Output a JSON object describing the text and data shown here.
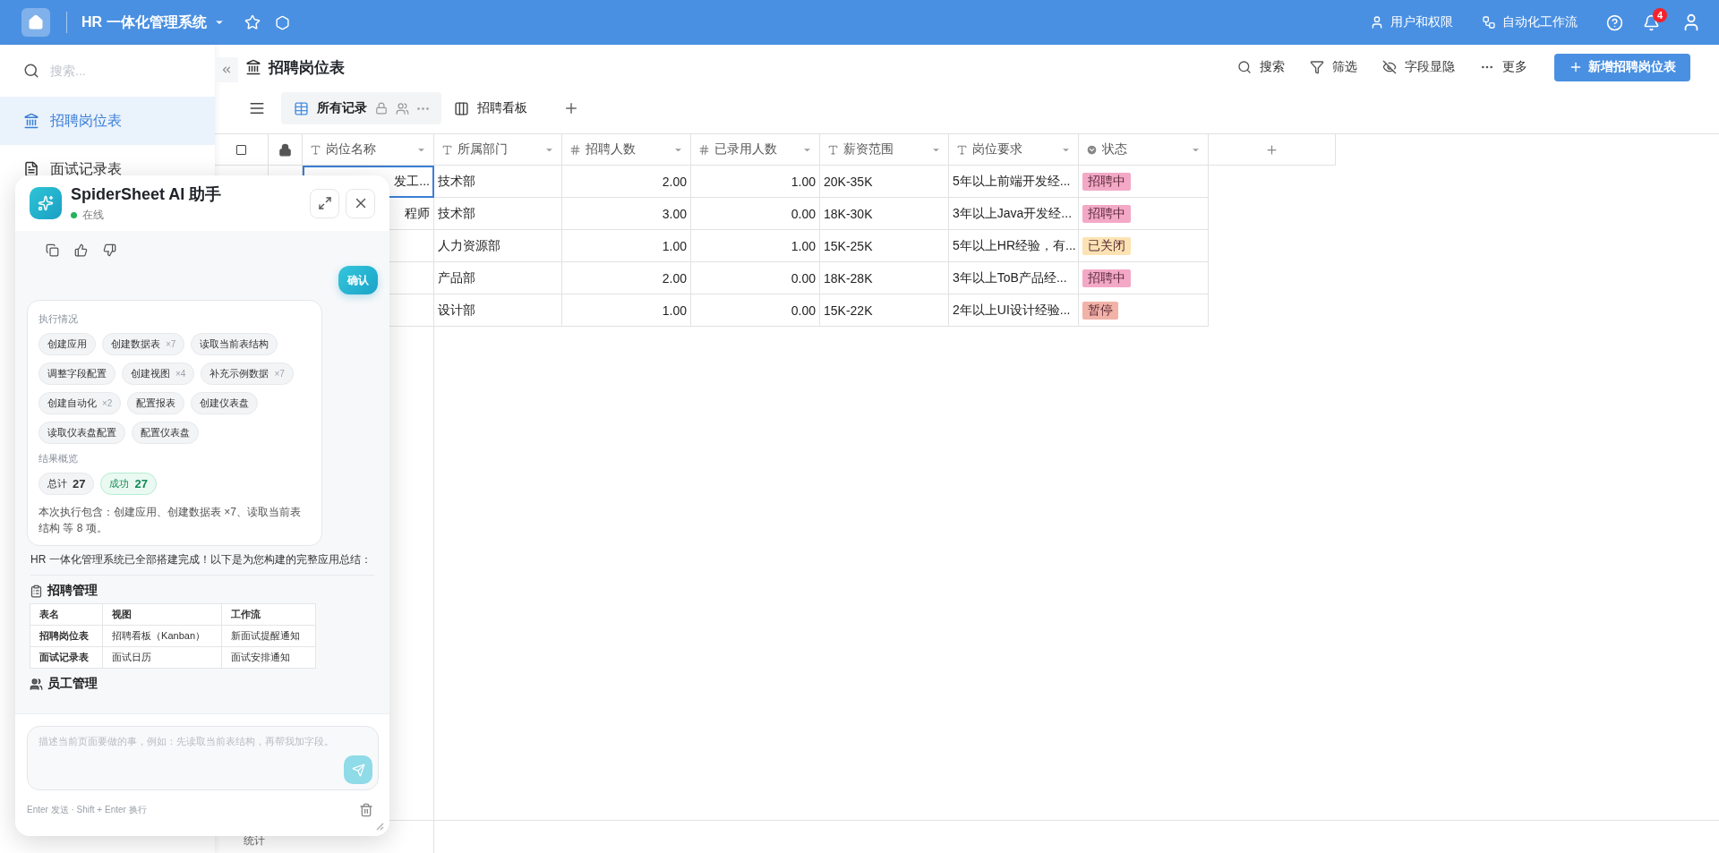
{
  "topbar": {
    "app_title": "HR 一体化管理系统",
    "links": [
      {
        "label": "用户和权限",
        "kind": "users"
      },
      {
        "label": "自动化工作流",
        "kind": "workflow"
      }
    ],
    "notification_count": "4"
  },
  "sidebar": {
    "search_placeholder": "搜索...",
    "items": [
      {
        "label": "招聘岗位表",
        "selected": true,
        "kind": "table"
      },
      {
        "label": "面试记录表",
        "selected": false,
        "kind": "form"
      }
    ]
  },
  "page": {
    "title": "招聘岗位表",
    "tools": [
      {
        "label": "搜索",
        "kind": "search"
      },
      {
        "label": "筛选",
        "kind": "filter"
      },
      {
        "label": "字段显隐",
        "kind": "visibility"
      },
      {
        "label": "更多",
        "kind": "more"
      }
    ],
    "add_button": "新增招聘岗位表"
  },
  "views": [
    {
      "label": "所有记录",
      "selected": true,
      "kind": "grid"
    },
    {
      "label": "招聘看板",
      "selected": false,
      "kind": "kanban"
    }
  ],
  "table": {
    "columns": [
      {
        "label": "岗位名称",
        "kind": "text"
      },
      {
        "label": "所属部门",
        "kind": "text"
      },
      {
        "label": "招聘人数",
        "kind": "number"
      },
      {
        "label": "已录用人数",
        "kind": "number"
      },
      {
        "label": "薪资范围",
        "kind": "text"
      },
      {
        "label": "岗位要求",
        "kind": "text"
      },
      {
        "label": "状态",
        "kind": "select"
      }
    ],
    "all_selected": false,
    "rows": [
      {
        "name_selected": true,
        "cells": [
          "发工...",
          "技术部",
          "2.00",
          "1.00",
          "20K-35K",
          "5年以上前端开发经..."
        ],
        "status": {
          "label": "招聘中",
          "color": "#f3a9c6"
        }
      },
      {
        "name_selected": false,
        "cells": [
          "程师",
          "技术部",
          "3.00",
          "0.00",
          "18K-30K",
          "3年以上Java开发经..."
        ],
        "status": {
          "label": "招聘中",
          "color": "#f3a9c6"
        }
      },
      {
        "name_selected": false,
        "cells": [
          "",
          "人力资源部",
          "1.00",
          "1.00",
          "15K-25K",
          "5年以上HR经验，有..."
        ],
        "status": {
          "label": "已关闭",
          "color": "#fde3b3"
        }
      },
      {
        "name_selected": false,
        "cells": [
          "",
          "产品部",
          "2.00",
          "0.00",
          "18K-28K",
          "3年以上ToB产品经..."
        ],
        "status": {
          "label": "招聘中",
          "color": "#f3a9c6"
        }
      },
      {
        "name_selected": false,
        "cells": [
          "",
          "设计部",
          "1.00",
          "0.00",
          "15K-22K",
          "2年以上UI设计经验..."
        ],
        "status": {
          "label": "暂停",
          "color": "#f2b2a7"
        }
      }
    ]
  },
  "status_bar": {
    "label": "统计"
  },
  "assistant": {
    "title": "SpiderSheet AI 助手",
    "status": "在线",
    "online": true,
    "confirm_label": "确认",
    "execution": {
      "heading": "执行情况",
      "steps": [
        {
          "label": "创建应用"
        },
        {
          "label": "创建数据表",
          "count": "×7"
        },
        {
          "label": "读取当前表结构"
        },
        {
          "label": "调整字段配置"
        },
        {
          "label": "创建视图",
          "count": "×4"
        },
        {
          "label": "补充示例数据",
          "count": "×7"
        },
        {
          "label": "创建自动化",
          "count": "×2"
        },
        {
          "label": "配置报表"
        },
        {
          "label": "创建仪表盘"
        },
        {
          "label": "读取仪表盘配置"
        },
        {
          "label": "配置仪表盘"
        }
      ],
      "result_heading": "结果概览",
      "results": [
        {
          "label": "总计",
          "value": "27",
          "kind": "total"
        },
        {
          "label": "成功",
          "value": "27",
          "kind": "success"
        }
      ],
      "summary": "本次执行包含：创建应用、创建数据表 ×7、读取当前表结构 等 8 项。"
    },
    "message": "HR 一体化管理系统已全部搭建完成！以下是为您构建的完整应用总结：",
    "sections": [
      {
        "heading": "招聘管理",
        "kind": "clipboard",
        "table": {
          "columns": [
            "表名",
            "视图",
            "工作流"
          ],
          "rows": [
            [
              "招聘岗位表",
              "招聘看板（Kanban）",
              "新面试提醒通知"
            ],
            [
              "面试记录表",
              "面试日历",
              "面试安排通知"
            ]
          ]
        }
      },
      {
        "heading": "员工管理",
        "kind": "people"
      }
    ],
    "input_placeholder": "描述当前页面要做的事，例如：先读取当前表结构，再帮我加字段。",
    "hint": "Enter 发送 · Shift + Enter 换行"
  }
}
